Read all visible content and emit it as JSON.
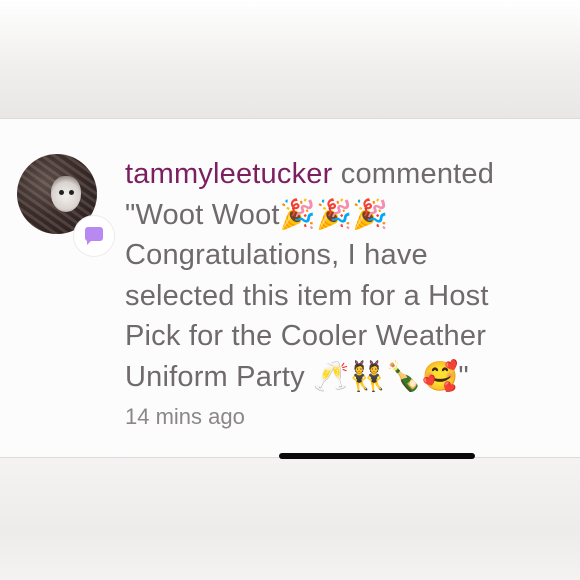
{
  "comment": {
    "username": "tammyleetucker",
    "action": "commented",
    "lines": [
      "\"Woot Woot🎉🎉🎉",
      "Congratulations, I have",
      "selected this item for a Host",
      "Pick for the Cooler Weather",
      "Uniform Party 🥂👯🍾🥰\""
    ],
    "timestamp": "14 mins ago"
  },
  "icons": {
    "avatar": "cat-avatar-photo",
    "badge": "comment-bubble-icon"
  },
  "colors": {
    "username": "#7c1f61",
    "text": "#6f6a6b",
    "badge": "#b989f2"
  }
}
